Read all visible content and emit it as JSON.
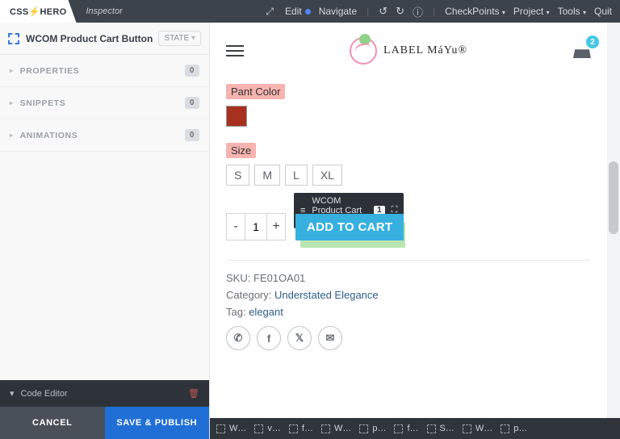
{
  "topbar": {
    "tab_active": "CSS⚡HERO",
    "tab_inactive": "Inspector",
    "edit": "Edit",
    "navigate": "Navigate",
    "checkpoints": "CheckPoints",
    "project": "Project",
    "tools": "Tools",
    "quit": "Quit"
  },
  "inspector": {
    "selected_element": "WCOM Product Cart Button",
    "state_label": "STATE",
    "sections": [
      {
        "label": "PROPERTIES",
        "count": "0"
      },
      {
        "label": "SNIPPETS",
        "count": "0"
      },
      {
        "label": "ANIMATIONS",
        "count": "0"
      }
    ],
    "code_editor": "Code Editor",
    "cancel": "CANCEL",
    "save": "SAVE & PUBLISH"
  },
  "site": {
    "brand": "LABEL MáYu®",
    "cart_count": "2"
  },
  "product": {
    "pant_color_label": "Pant Color",
    "pant_color_value": "#a8301f",
    "size_label": "Size",
    "sizes": [
      "S",
      "M",
      "L",
      "XL"
    ],
    "qty": "1",
    "add_to_cart": "ADD TO CART",
    "sku_label": "SKU:",
    "sku": "FE01OA01",
    "category_label": "Category:",
    "category": "Understated Elegance",
    "tag_label": "Tag:",
    "tag": "elegant"
  },
  "overlay": {
    "name": "WCOM Product Cart Button",
    "count": "1"
  },
  "breadcrumbs": [
    "W…",
    "v…",
    "f…",
    "W…",
    "p…",
    "f…",
    "S…",
    "W…",
    "p…"
  ]
}
